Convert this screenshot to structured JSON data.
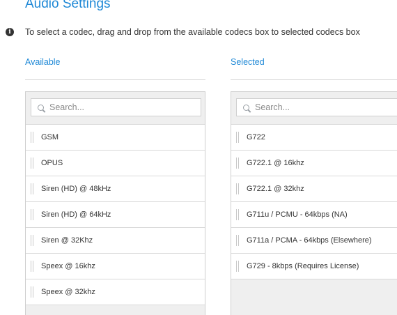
{
  "header": {
    "title": "Audio Settings",
    "info_text": "To select a codec, drag and drop from the available codecs box to selected codecs box"
  },
  "available": {
    "label": "Available",
    "search_placeholder": "Search...",
    "items": [
      {
        "label": "GSM"
      },
      {
        "label": "OPUS"
      },
      {
        "label": "Siren (HD) @ 48kHz"
      },
      {
        "label": "Siren (HD) @ 64kHz"
      },
      {
        "label": "Siren @ 32Khz"
      },
      {
        "label": "Speex @ 16khz"
      },
      {
        "label": "Speex @ 32khz"
      }
    ]
  },
  "selected": {
    "label": "Selected",
    "search_placeholder": "Search...",
    "items": [
      {
        "label": "G722"
      },
      {
        "label": "G722.1 @ 16khz"
      },
      {
        "label": "G722.1 @ 32khz"
      },
      {
        "label": "G711u / PCMU - 64kbps (NA)"
      },
      {
        "label": "G711a / PCMA - 64kbps (Elsewhere)"
      },
      {
        "label": "G729 - 8kbps (Requires License)"
      }
    ]
  },
  "colors": {
    "accent": "#1e88d6",
    "panel_background": "#efefef",
    "text": "#333333"
  }
}
